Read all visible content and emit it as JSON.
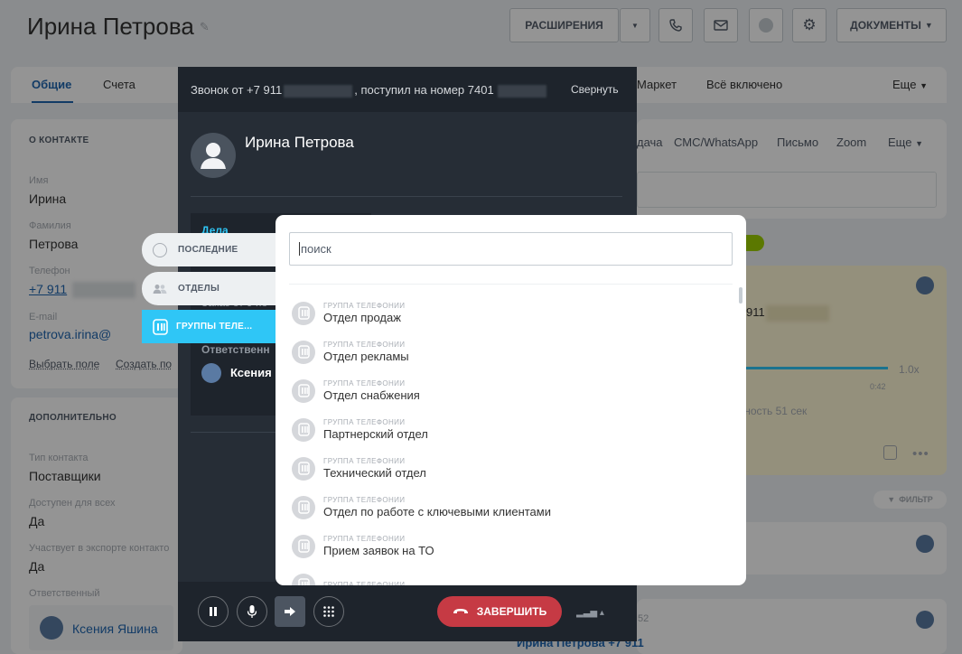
{
  "header": {
    "title": "Ирина Петрова",
    "extensions_label": "РАСШИРЕНИЯ",
    "documents_label": "ДОКУМЕНТЫ"
  },
  "tabs": [
    {
      "label": "Общие"
    },
    {
      "label": "Счета"
    },
    {
      "label": "Маркет"
    },
    {
      "label": "Всё включено"
    },
    {
      "label": "Еще"
    }
  ],
  "left": {
    "about_title": "О КОНТАКТЕ",
    "fields": [
      {
        "label": "Имя",
        "value": "Ирина"
      },
      {
        "label": "Фамилия",
        "value": "Петрова"
      },
      {
        "label": "Телефон",
        "value": "+7 911"
      },
      {
        "label": "E-mail",
        "value": "petrova.irina@"
      }
    ],
    "select_field": "Выбрать поле",
    "create_field": "Создать по",
    "extra_title": "ДОПОЛНИТЕЛЬНО",
    "extra_fields": [
      {
        "label": "Тип контакта",
        "value": "Поставщики"
      },
      {
        "label": "Доступен для всех",
        "value": "Да"
      },
      {
        "label": "Участвует в экспорте контакто",
        "value": "Да"
      }
    ],
    "responsible_label": "Ответственный",
    "responsible_name": "Ксения Яшина"
  },
  "right": {
    "activity_tabs": [
      "дача",
      "СМС/WhatsApp",
      "Письмо",
      "Zoom",
      "Еще"
    ],
    "speed": "1.0x",
    "time": "0:42",
    "duration": "ьность 51 сек",
    "phone_frag": "911",
    "filter": "ФИЛЬТР",
    "bottom_frag": "52",
    "bottom_name": "Ирина Петрова +7 911"
  },
  "call": {
    "header_prefix": "Звонок от +7 911",
    "header_middle": ", поступил на номер 7401",
    "collapse": "Свернуть",
    "caller_name": "Ирина Петрова",
    "deal_label": "Дела",
    "order_frag": "Заказ от 9 по",
    "responsible_frag": "Ответственн",
    "responsible_name": "Ксения",
    "end_label": "ЗАВЕРШИТЬ"
  },
  "side_tabs": [
    {
      "label": "ПОСЛЕДНИЕ",
      "icon": "clock-icon"
    },
    {
      "label": "ОТДЕЛЫ",
      "icon": "people-icon"
    },
    {
      "label": "ГРУППЫ ТЕЛЕ...",
      "icon": "telephony-group-icon"
    }
  ],
  "popup": {
    "search_placeholder": "поиск",
    "caption": "ГРУППА ТЕЛЕФОНИИ",
    "items": [
      {
        "caption": "ГРУППА ТЕЛЕФОНИИ",
        "name": "Отдел продаж"
      },
      {
        "caption": "ГРУППА ТЕЛЕФОНИИ",
        "name": "Отдел рекламы"
      },
      {
        "caption": "ГРУППА ТЕЛЕФОНИИ",
        "name": "Отдел снабжения"
      },
      {
        "caption": "ГРУППА ТЕЛЕФОНИИ",
        "name": "Партнерский отдел"
      },
      {
        "caption": "ГРУППА ТЕЛЕФОНИИ",
        "name": "Технический отдел"
      },
      {
        "caption": "ГРУППА ТЕЛЕФОНИИ",
        "name": "Отдел по работе с ключевыми клиентами"
      },
      {
        "caption": "ГРУППА ТЕЛЕФОНИИ",
        "name": "Прием заявок на ТО"
      }
    ]
  },
  "colors": {
    "accent": "#2fc6f6",
    "end_call": "#c63a44",
    "link": "#2066b0",
    "call_bg": "#262d36"
  }
}
